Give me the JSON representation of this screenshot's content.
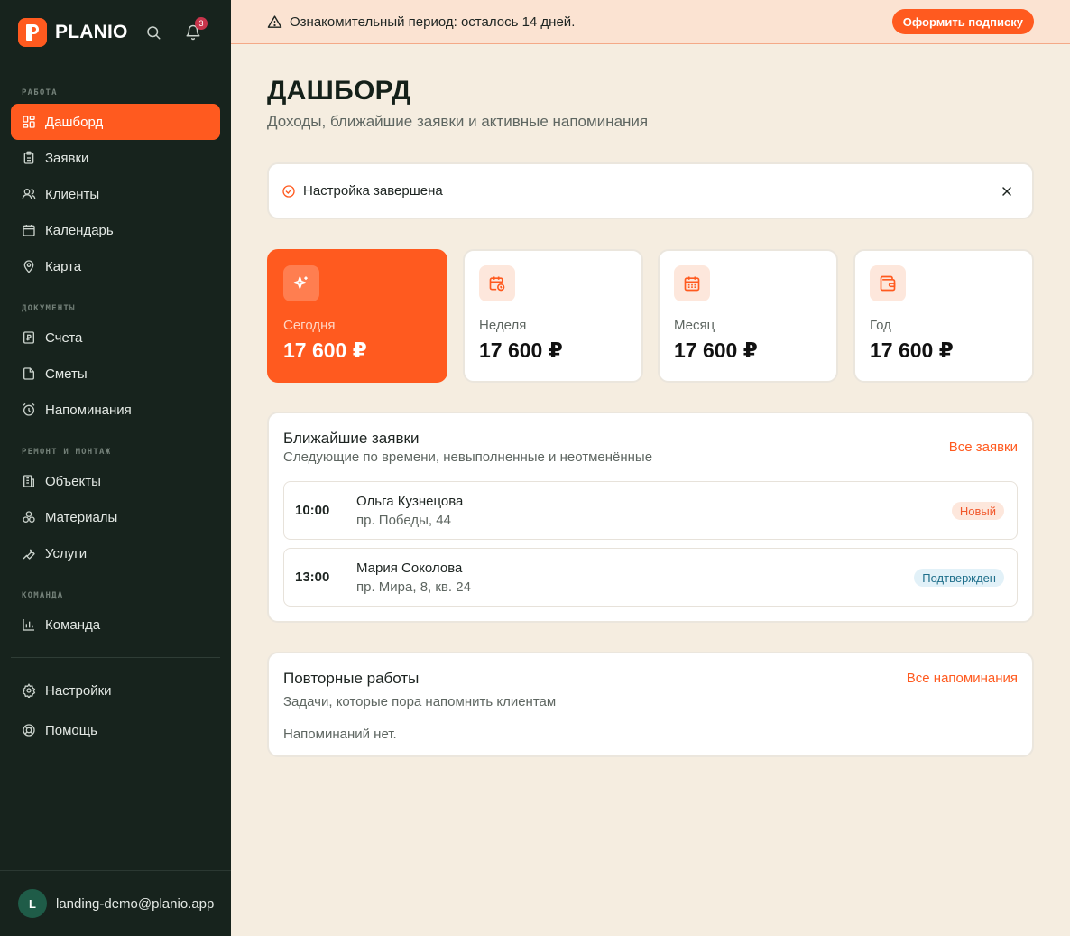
{
  "brand": {
    "name": "PLANIO"
  },
  "notifications": {
    "count": "3"
  },
  "sidebar": {
    "sections": [
      {
        "label": "РАБОТА"
      },
      {
        "label": "ДОКУМЕНТЫ"
      },
      {
        "label": "РЕМОНТ И МОНТАЖ"
      },
      {
        "label": "КОМАНДА"
      }
    ],
    "items": [
      {
        "label": "Дашборд",
        "icon": "dashboard-icon",
        "active": true
      },
      {
        "label": "Заявки",
        "icon": "clipboard-icon"
      },
      {
        "label": "Клиенты",
        "icon": "users-icon"
      },
      {
        "label": "Календарь",
        "icon": "calendar-icon"
      },
      {
        "label": "Карта",
        "icon": "map-pin-icon"
      },
      {
        "label": "Счета",
        "icon": "invoice-icon"
      },
      {
        "label": "Сметы",
        "icon": "document-icon"
      },
      {
        "label": "Напоминания",
        "icon": "alarm-icon"
      },
      {
        "label": "Объекты",
        "icon": "building-icon"
      },
      {
        "label": "Материалы",
        "icon": "boxes-icon"
      },
      {
        "label": "Услуги",
        "icon": "wrench-icon"
      },
      {
        "label": "Команда",
        "icon": "bar-chart-icon"
      }
    ],
    "footer_items": [
      {
        "label": "Настройки",
        "icon": "gear-icon"
      },
      {
        "label": "Помощь",
        "icon": "lifebuoy-icon"
      }
    ],
    "user": {
      "initial": "L",
      "email": "landing-demo@planio.app"
    }
  },
  "trial": {
    "text": "Ознакомительный период: осталось 14 дней.",
    "button": "Оформить подписку"
  },
  "page": {
    "title": "ДАШБОРД",
    "subtitle": "Доходы, ближайшие заявки и активные напоминания"
  },
  "alert": {
    "text": "Настройка завершена"
  },
  "stats": [
    {
      "label": "Сегодня",
      "value": "17 600 ₽",
      "icon": "sparkle-icon"
    },
    {
      "label": "Неделя",
      "value": "17 600 ₽",
      "icon": "calendar-clock-icon"
    },
    {
      "label": "Месяц",
      "value": "17 600 ₽",
      "icon": "calendar-grid-icon"
    },
    {
      "label": "Год",
      "value": "17 600 ₽",
      "icon": "wallet-icon"
    }
  ],
  "upcoming": {
    "title": "Ближайшие заявки",
    "subtitle": "Следующие по времени, невыполненные и неотменённые",
    "link": "Все заявки",
    "rows": [
      {
        "time": "10:00",
        "name": "Ольга Кузнецова",
        "address": "пр. Победы, 44",
        "status": "Новый",
        "status_color": "#f1582c"
      },
      {
        "time": "13:00",
        "name": "Мария Соколова",
        "address": "пр. Мира, 8, кв. 24",
        "status": "Подтвержден",
        "status_color": "#1f6f8b"
      }
    ]
  },
  "repeat": {
    "title": "Повторные работы",
    "subtitle": "Задачи, которые пора напомнить клиентам",
    "link": "Все напоминания",
    "empty": "Напоминаний нет."
  }
}
